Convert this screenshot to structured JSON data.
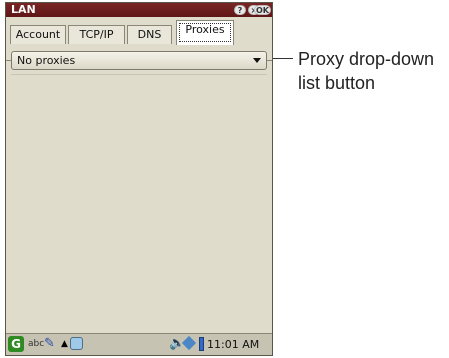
{
  "window": {
    "title": "LAN",
    "help_label": "?",
    "close_label": "×",
    "ok_label": "OK"
  },
  "tabs": [
    {
      "label": "Account"
    },
    {
      "label": "TCP/IP"
    },
    {
      "label": "DNS"
    },
    {
      "label": "Proxies",
      "active": true
    }
  ],
  "proxy_select": {
    "value": "No proxies"
  },
  "taskbar": {
    "kbd_label": "abc",
    "clock": "11:01 AM"
  },
  "annotation": {
    "text": "Proxy drop-down list button"
  }
}
